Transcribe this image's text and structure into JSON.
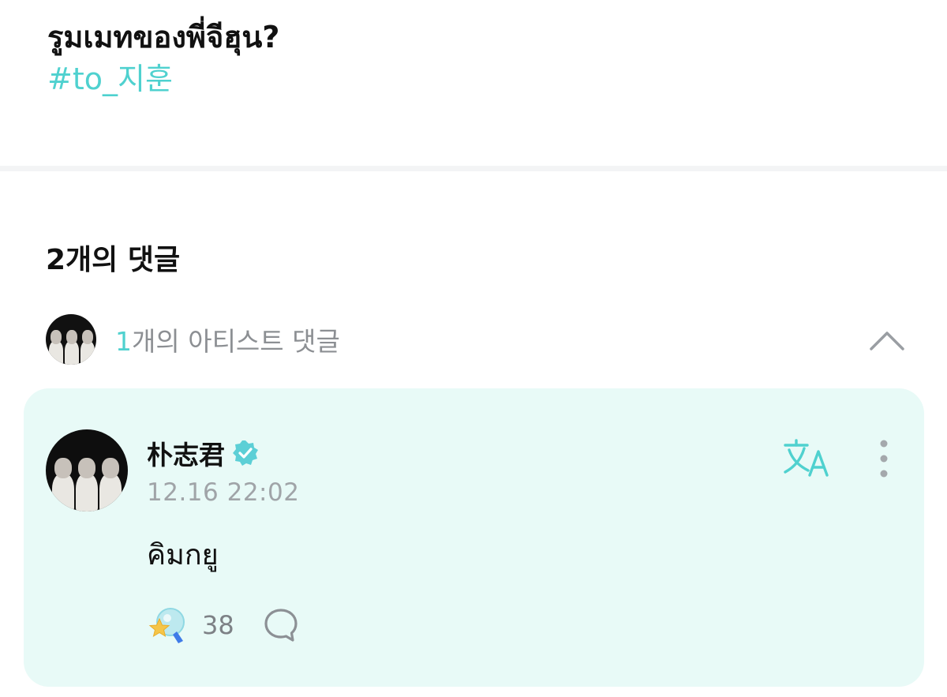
{
  "post": {
    "text": "รูมเมทของพี่จีฮุน?",
    "hashtag": "#to_지훈"
  },
  "comments": {
    "count_label": "2개의 댓글",
    "artist_toggle": {
      "count": "1",
      "label": "개의 아티스트 댓글"
    }
  },
  "artist_comment": {
    "author": "朴志君",
    "timestamp": "12.16 22:02",
    "text": "คิมกยู",
    "like_count": "38",
    "like_icon": "light-stick-star-icon",
    "translate_icon": "translate-icon",
    "more_icon": "more-vertical-icon",
    "reply_icon": "speech-bubble-icon"
  },
  "colors": {
    "accent": "#4fd1cf",
    "card_bg": "#e8faf7",
    "muted": "#8c8f93"
  }
}
